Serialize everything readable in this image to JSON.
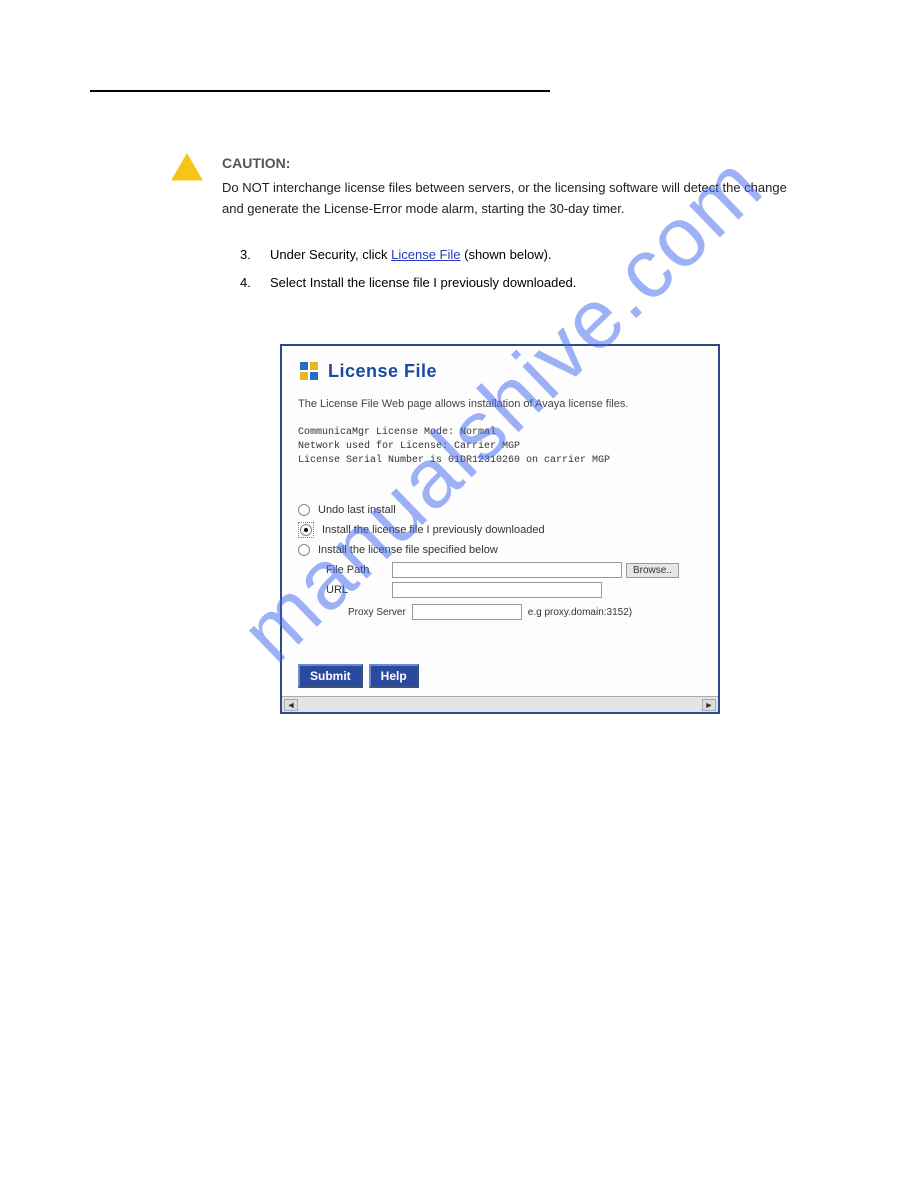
{
  "watermark": "manualshive.com",
  "caution": {
    "label": "CAUTION:",
    "text": "Do NOT interchange license files between servers, or the licensing software will detect the change and generate the License-Error mode alarm, starting the 30-day timer."
  },
  "steps": {
    "s3": {
      "num": "3.",
      "before": "Under Security, click ",
      "link": "License File",
      "after": " (shown below)."
    },
    "s4": {
      "num": "4.",
      "text": "Select Install the license file I previously downloaded."
    }
  },
  "app": {
    "title": "License File",
    "desc": "The License File Web page allows installation of Avaya license files.",
    "mono_line1": "CommunicaMgr License Mode: Normal",
    "mono_line2": "Network used for License: Carrier MGP",
    "mono_line3": "License Serial Number is 01DR12310260 on carrier MGP",
    "radio_undo": "Undo last install",
    "radio_prev": "Install the license file I previously downloaded",
    "radio_below": "Install the license file specified below",
    "field_path_label": "File Path",
    "field_url_label": "URL",
    "browse_label": "Browse..",
    "proxy_label": "Proxy Server",
    "proxy_hint": "e.g proxy.domain:3152)",
    "submit_label": "Submit",
    "help_label": "Help"
  }
}
